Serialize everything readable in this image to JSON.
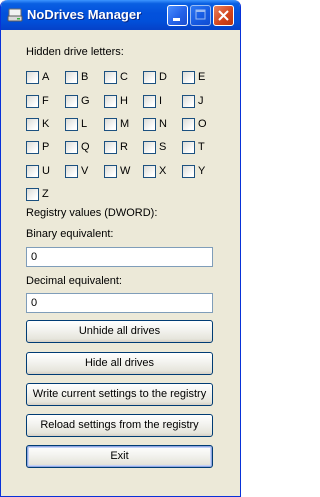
{
  "window": {
    "title": "NoDrives Manager"
  },
  "hidden_drives": {
    "label": "Hidden drive letters:",
    "letters": [
      "A",
      "B",
      "C",
      "D",
      "E",
      "F",
      "G",
      "H",
      "I",
      "J",
      "K",
      "L",
      "M",
      "N",
      "O",
      "P",
      "Q",
      "R",
      "S",
      "T",
      "U",
      "V",
      "W",
      "X",
      "Y",
      "Z"
    ],
    "checked": []
  },
  "registry": {
    "label": "Registry values (DWORD):",
    "binary_label": "Binary equivalent:",
    "binary_value": "0",
    "decimal_label": "Decimal equivalent:",
    "decimal_value": "0"
  },
  "buttons": {
    "unhide": "Unhide all drives",
    "hide": "Hide all drives",
    "write": "Write current settings to the registry",
    "reload": "Reload settings from the registry",
    "exit": "Exit"
  }
}
